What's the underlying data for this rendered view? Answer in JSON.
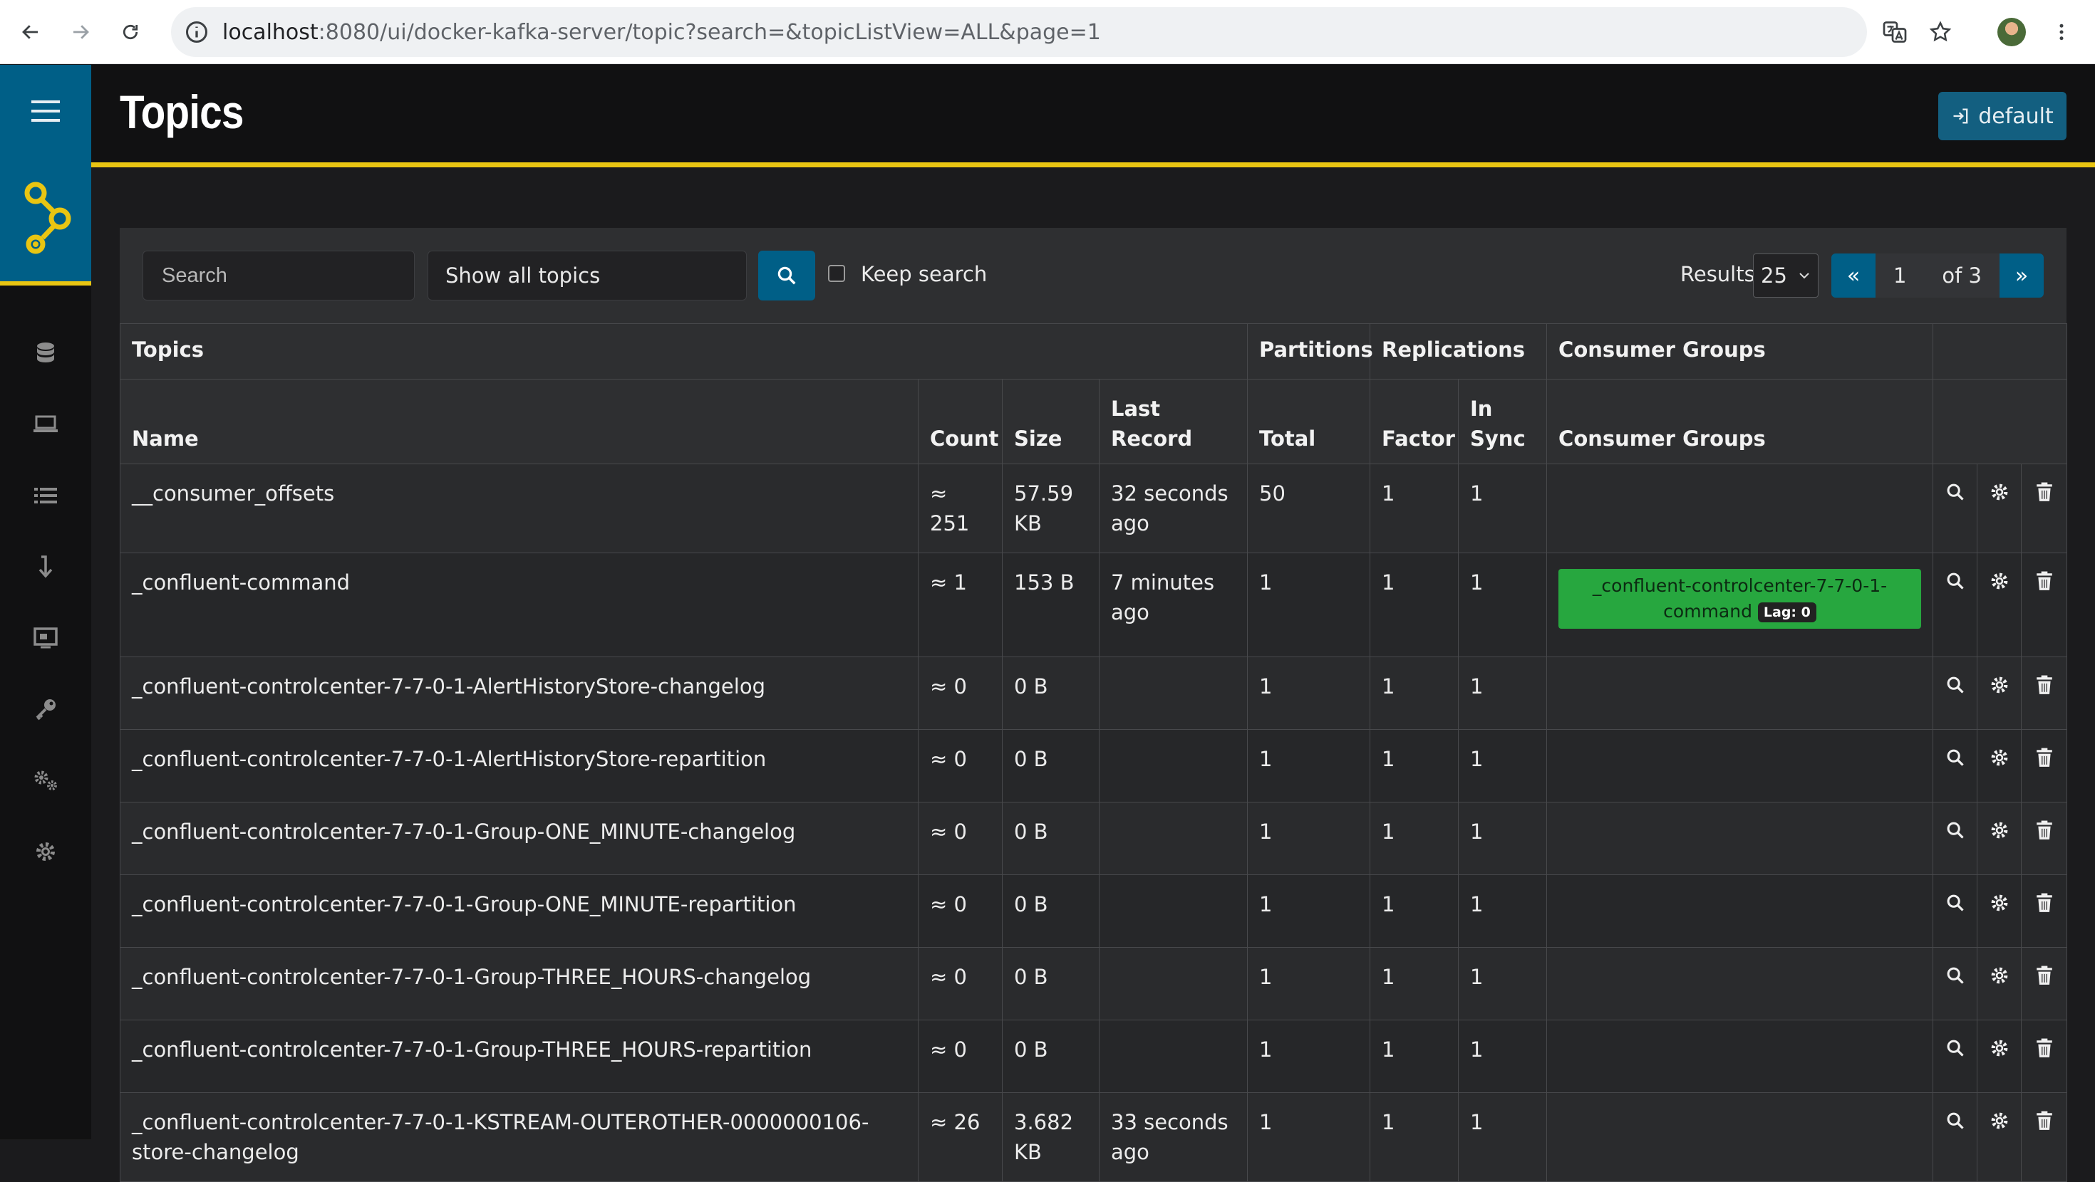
{
  "browser": {
    "url_host": "localhost",
    "url_rest": ":8080/ui/docker-kafka-server/topic?search=&topicListView=ALL&page=1"
  },
  "header": {
    "title": "Topics",
    "cluster_button": "default"
  },
  "toolbar": {
    "search_placeholder": "Search",
    "view_select": "Show all topics",
    "keep_search_label": "Keep search",
    "results_label": "Results",
    "results_per_page": "25",
    "pager_first": "«",
    "pager_current": "1",
    "pager_total": "of 3",
    "pager_next": "»"
  },
  "table": {
    "group_headers": {
      "topics": "Topics",
      "partitions": "Partitions",
      "replications": "Replications",
      "consumer_groups": "Consumer Groups"
    },
    "columns": {
      "name": "Name",
      "count": "Count",
      "size": "Size",
      "last_record": "Last Record",
      "total": "Total",
      "factor": "Factor",
      "in_sync": "In Sync",
      "consumer_groups": "Consumer Groups"
    },
    "rows": [
      {
        "name": "__consumer_offsets",
        "count": "≈ 251",
        "size": "57.59 KB",
        "last_record": "32 seconds ago",
        "total": "50",
        "factor": "1",
        "in_sync": "1",
        "group": "",
        "lag": ""
      },
      {
        "name": "_confluent-command",
        "count": "≈ 1",
        "size": "153 B",
        "last_record": "7 minutes ago",
        "total": "1",
        "factor": "1",
        "in_sync": "1",
        "group": "_confluent-controlcenter-7-7-0-1-command",
        "lag": "Lag: 0"
      },
      {
        "name": "_confluent-controlcenter-7-7-0-1-AlertHistoryStore-changelog",
        "count": "≈ 0",
        "size": "0 B",
        "last_record": "",
        "total": "1",
        "factor": "1",
        "in_sync": "1",
        "group": "",
        "lag": ""
      },
      {
        "name": "_confluent-controlcenter-7-7-0-1-AlertHistoryStore-repartition",
        "count": "≈ 0",
        "size": "0 B",
        "last_record": "",
        "total": "1",
        "factor": "1",
        "in_sync": "1",
        "group": "",
        "lag": ""
      },
      {
        "name": "_confluent-controlcenter-7-7-0-1-Group-ONE_MINUTE-changelog",
        "count": "≈ 0",
        "size": "0 B",
        "last_record": "",
        "total": "1",
        "factor": "1",
        "in_sync": "1",
        "group": "",
        "lag": ""
      },
      {
        "name": "_confluent-controlcenter-7-7-0-1-Group-ONE_MINUTE-repartition",
        "count": "≈ 0",
        "size": "0 B",
        "last_record": "",
        "total": "1",
        "factor": "1",
        "in_sync": "1",
        "group": "",
        "lag": ""
      },
      {
        "name": "_confluent-controlcenter-7-7-0-1-Group-THREE_HOURS-changelog",
        "count": "≈ 0",
        "size": "0 B",
        "last_record": "",
        "total": "1",
        "factor": "1",
        "in_sync": "1",
        "group": "",
        "lag": ""
      },
      {
        "name": "_confluent-controlcenter-7-7-0-1-Group-THREE_HOURS-repartition",
        "count": "≈ 0",
        "size": "0 B",
        "last_record": "",
        "total": "1",
        "factor": "1",
        "in_sync": "1",
        "group": "",
        "lag": ""
      },
      {
        "name": "_confluent-controlcenter-7-7-0-1-KSTREAM-OUTEROTHER-0000000106-store-changelog",
        "count": "≈ 26",
        "size": "3.682 KB",
        "last_record": "33 seconds ago",
        "total": "1",
        "factor": "1",
        "in_sync": "1",
        "group": "",
        "lag": ""
      }
    ]
  },
  "sidebar": {
    "items": [
      "menu-icon",
      "database-icon",
      "laptop-icon",
      "list-icon",
      "arrow-down-icon",
      "monitor-icon",
      "key-icon",
      "gears-icon",
      "gear-icon"
    ]
  },
  "colors": {
    "accent_yellow": "#e9c512",
    "brand_blue": "#005f87",
    "group_green": "#27a73f"
  }
}
